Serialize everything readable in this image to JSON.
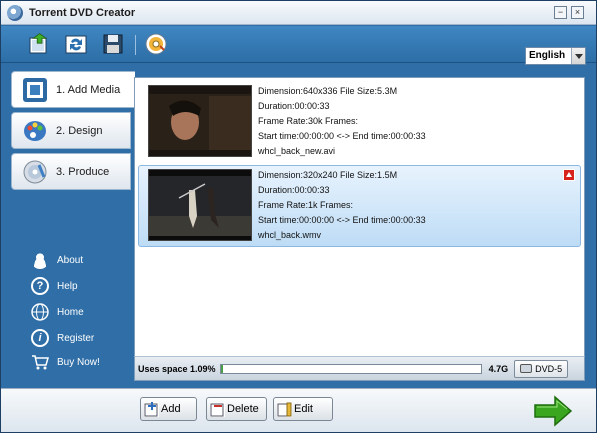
{
  "window": {
    "title": "Torrent DVD Creator",
    "minimize": "−",
    "close": "×"
  },
  "toolbar": {
    "buttons": [
      "import-media",
      "refresh",
      "save",
      "burn-disc"
    ],
    "language": "English"
  },
  "steps": [
    {
      "label": "1. Add Media",
      "active": true
    },
    {
      "label": "2. Design",
      "active": false
    },
    {
      "label": "3. Produce",
      "active": false
    }
  ],
  "links": [
    {
      "label": "About"
    },
    {
      "label": "Help"
    },
    {
      "label": "Home"
    },
    {
      "label": "Register"
    },
    {
      "label": "Buy Now!"
    }
  ],
  "media": [
    {
      "line1": "Dimension:640x336  File Size:5.3M",
      "line2": "Duration:00:00:33",
      "line3": "Frame Rate:30k  Frames:",
      "line4": "Start time:00:00:00 <-> End time:00:00:33",
      "filename": "whcl_back_new.avi",
      "selected": false
    },
    {
      "line1": "Dimension:320x240  File Size:1.5M",
      "line2": "Duration:00:00:33",
      "line3": "Frame Rate:1k  Frames:",
      "line4": "Start time:00:00:00 <-> End time:00:00:33",
      "filename": "whcl_back.wmv",
      "selected": true
    }
  ],
  "status": {
    "usage_label": "Uses space 1.09%",
    "usage_fraction": 0.0109,
    "capacity": "4.7G",
    "disc_type": "DVD-5"
  },
  "actions": {
    "add": "Add",
    "delete": "Delete",
    "edit": "Edit"
  },
  "colors": {
    "accent": "#2f6ea6",
    "next_arrow": "#3aa61f",
    "selected_row": "#bedcf6"
  }
}
